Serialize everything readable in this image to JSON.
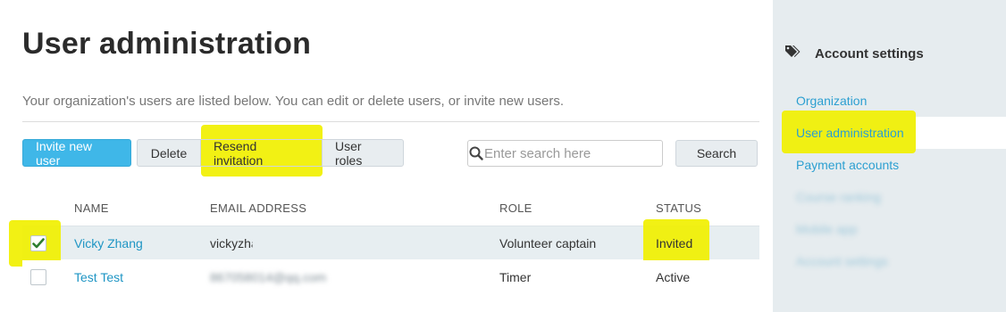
{
  "page": {
    "title": "User administration",
    "subtitle": "Your organization's users are listed below. You can edit or delete users, or invite new users."
  },
  "toolbar": {
    "invite_label": "Invite new user",
    "delete_label": "Delete",
    "resend_label": "Resend invitation",
    "roles_label": "User roles"
  },
  "search": {
    "placeholder": "Enter search here",
    "button_label": "Search"
  },
  "table": {
    "columns": [
      "NAME",
      "EMAIL ADDRESS",
      "ROLE",
      "STATUS"
    ],
    "rows": [
      {
        "name": "Vicky Zhang",
        "email": "vickyzhang@qq.com",
        "role": "Volunteer captain",
        "status": "Invited",
        "checked": true
      },
      {
        "name": "Test Test",
        "email": "867058014@qq.com",
        "role": "Timer",
        "status": "Active",
        "checked": false
      }
    ]
  },
  "sidebar": {
    "title": "Account settings",
    "items": [
      {
        "label": "Organization",
        "active": false
      },
      {
        "label": "User administration",
        "active": true
      },
      {
        "label": "Payment accounts",
        "active": false
      },
      {
        "label": "Course ranking",
        "active": false
      },
      {
        "label": "Mobile app",
        "active": false
      },
      {
        "label": "Account settings",
        "active": false
      }
    ]
  },
  "colors": {
    "accent": "#3fb7e8",
    "link": "#2c9fd1",
    "highlight": "#f1f000",
    "check": "#2e7d32"
  },
  "icons": {
    "sidebar_header": "tags-icon",
    "search": "search-icon",
    "check": "checkmark-icon"
  }
}
